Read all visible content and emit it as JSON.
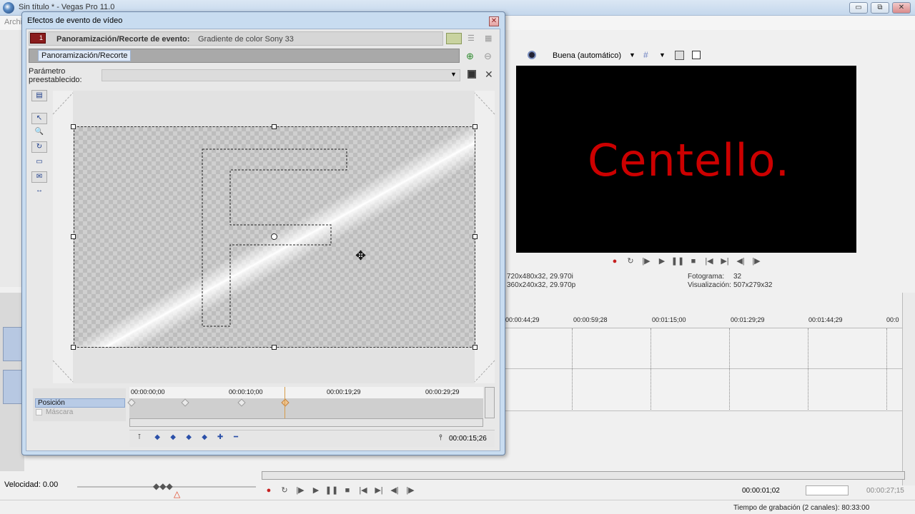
{
  "app": {
    "title": "Sin título * - Vegas Pro 11.0",
    "menu_first": "Archivo",
    "minimize": "▭",
    "restore": "⧉",
    "close": "✕"
  },
  "dialog": {
    "title": "Efectos de evento de vídeo",
    "close": "✕",
    "chain_badge": "1",
    "chain_label": "Panoramización/Recorte de evento:",
    "chain_value": "Gradiente de color Sony 33",
    "plugin_tab": "Panoramización/Recorte",
    "preset_label_line1": "Parámetro",
    "preset_label_line2": "preestablecido:",
    "preset_value": ""
  },
  "keyframes": {
    "rows": [
      "Posición",
      "Máscara"
    ],
    "ruler_labels": [
      "00:00:00;00",
      "00:00:10;00",
      "00:00:19;29",
      "00:00:29;29"
    ],
    "current_time": "00:00:15;26"
  },
  "preview": {
    "quality": "Buena (automático)",
    "overlay_text": "Centello.",
    "project_info": "720x480x32, 29.970i",
    "preview_info": "360x240x32, 29.970p",
    "frame_label": "Fotograma:",
    "frame_value": "32",
    "display_label": "Visualización:",
    "display_value": "507x279x32"
  },
  "timeline": {
    "ruler_labels": [
      "00:00:44;29",
      "00:00:59;28",
      "00:01:15;00",
      "00:01:29;29",
      "00:01:44;29",
      "00:0"
    ],
    "cursor_time": "00:00:01;02",
    "end_time": "00:00:27;15",
    "speed_label": "Velocidad: 0.00",
    "status": "Tiempo de grabación (2 canales): 80:33:00"
  }
}
